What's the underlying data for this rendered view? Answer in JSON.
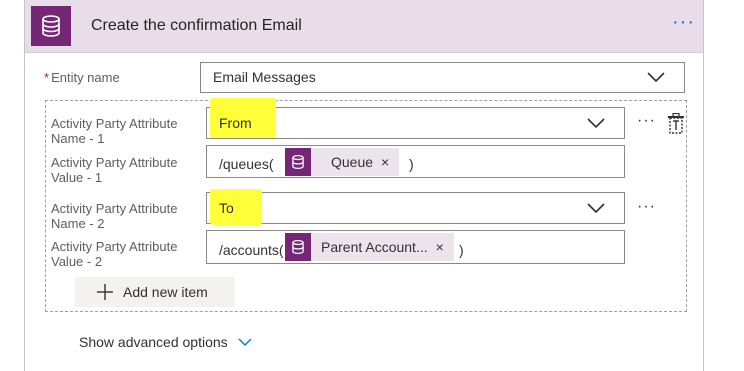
{
  "header": {
    "title": "Create the confirmation Email",
    "icon": "database-icon",
    "more_icon": "ellipsis-icon",
    "more_label": "···",
    "colors": {
      "band": "#e8dde8",
      "icon_tile": "#742774",
      "more": "#0078d4"
    }
  },
  "entity": {
    "required_mark": "*",
    "label": "Entity name",
    "value": "Email Messages"
  },
  "items": [
    {
      "name_label": [
        "Activity Party Attribute",
        "Name - 1"
      ],
      "name_value": "From",
      "value_label": [
        "Activity Party Attribute",
        "Value - 1"
      ],
      "value_prefix": "/queues(",
      "value_token": "Queue",
      "value_suffix": ")"
    },
    {
      "name_label": [
        "Activity Party Attribute",
        "Name - 2"
      ],
      "name_value": "To",
      "value_label": [
        "Activity Party Attribute",
        "Value - 2"
      ],
      "value_prefix": "/accounts(",
      "value_token": "Parent Account...",
      "value_suffix": ")"
    }
  ],
  "token_close": "×",
  "row_more": "···",
  "add_item": {
    "label": "Add new item",
    "icon": "plus-icon"
  },
  "advanced": {
    "label": "Show advanced options",
    "icon": "chevron-down-icon"
  },
  "highlight_color": "#ffff3a"
}
